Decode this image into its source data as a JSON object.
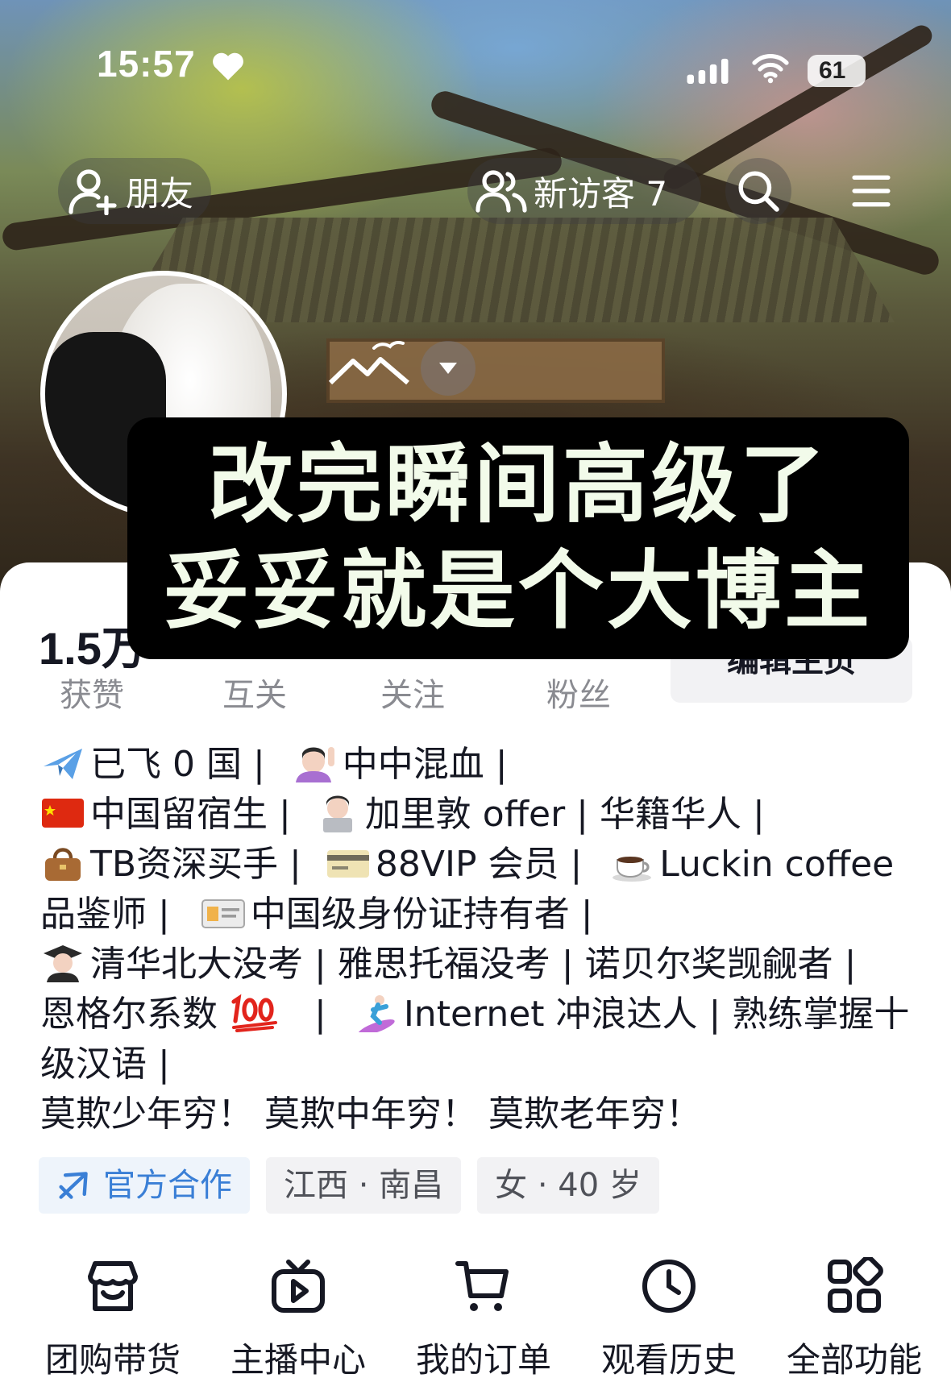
{
  "status_bar": {
    "time": "15:57",
    "battery": "61"
  },
  "nav": {
    "friends_label": "朋友",
    "visitors_label": "新访客 7"
  },
  "banner": {
    "line1": "改完瞬间高级了",
    "line2": "妥妥就是个大博主"
  },
  "stats": {
    "likes_value": "1.5万",
    "labels": [
      "获赞",
      "互关",
      "关注",
      "粉丝"
    ],
    "edit_label": "编辑主页"
  },
  "bio": {
    "line1_a": "已飞 0 国 |",
    "line1_b": "中中混血 |",
    "line2_a": "中国留宿生 |",
    "line2_b": "加里敦 offer | 华籍华人 |",
    "line3_a": "TB资深买手 |",
    "line3_b": "88VIP 会员 |",
    "line3_c": "Luckin coffee",
    "line4_a": "品鉴师 |",
    "line4_b": "中国级身份证持有者 |",
    "line5": "清华北大没考 | 雅思托福没考 | 诺贝尔奖觊觎者 |",
    "line6_a": "恩格尔系数",
    "line6_b": "|",
    "line6_c": "Internet 冲浪达人 | 熟练掌握十",
    "line7": "级汉语 |",
    "line8": "莫欺少年穷！ 莫欺中年穷！ 莫欺老年穷！"
  },
  "tags": {
    "official": "官方合作",
    "location": "江西 · 南昌",
    "gender_age": "女 · 40 岁"
  },
  "features": [
    {
      "label": "团购带货",
      "icon": "shop-icon"
    },
    {
      "label": "主播中心",
      "icon": "tv-play-icon"
    },
    {
      "label": "我的订单",
      "icon": "cart-icon"
    },
    {
      "label": "观看历史",
      "icon": "clock-icon"
    },
    {
      "label": "全部功能",
      "icon": "grid-icon"
    }
  ],
  "colors": {
    "accent_blue": "#3a7fd6",
    "banner_bg": "#000000",
    "banner_text": "#f2fbea",
    "label_gray": "#8a8b91"
  }
}
